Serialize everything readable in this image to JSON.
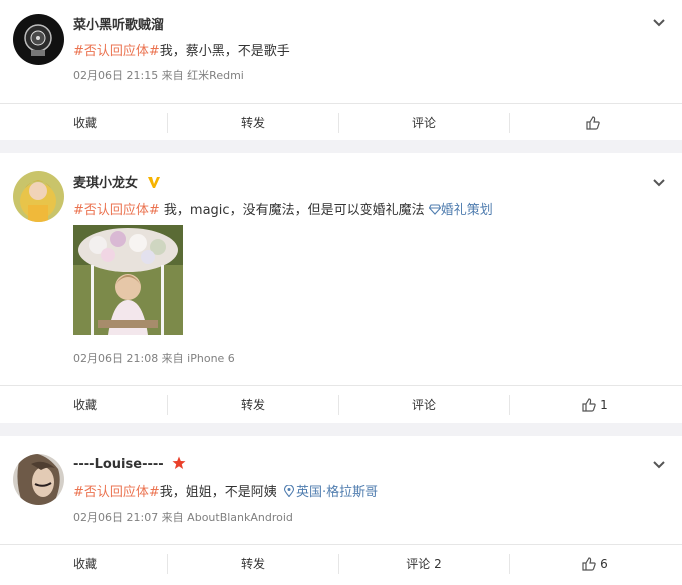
{
  "posts": [
    {
      "user": "菜小黑听歌贼溜",
      "hashtag": "#否认回应体#",
      "body": "我，蔡小黑，不是歌手",
      "meta": "02月06日 21:15 来自 红米Redmi",
      "actions": {
        "favorite": "收藏",
        "repost": "转发",
        "comment": "评论",
        "like": ""
      }
    },
    {
      "user": "麦琪小龙女",
      "hashtag": "#否认回应体#",
      "body": " 我，magic，没有魔法，但是可以变婚礼魔法",
      "link": "婚礼策划",
      "meta": "02月06日 21:08 来自 iPhone 6",
      "actions": {
        "favorite": "收藏",
        "repost": "转发",
        "comment": "评论",
        "like": "1"
      }
    },
    {
      "user": "----Louise----",
      "hashtag": "#否认回应体#",
      "body": "我，姐姐，不是阿姨",
      "link": "英国·格拉斯哥",
      "meta": "02月06日 21:07 来自 AboutBlankAndroid",
      "actions": {
        "favorite": "收藏",
        "repost": "转发",
        "comment": "评论 2",
        "like": "6"
      }
    }
  ],
  "colors": {
    "hashtag": "#eb7350",
    "link": "#507daf",
    "verified": "#f6b300",
    "star": "#e9402b"
  },
  "icons": [
    "chevron-down-icon",
    "thumbs-up-icon",
    "verified-badge-icon",
    "star-badge-icon",
    "location-pin-icon",
    "topic-link-icon"
  ]
}
